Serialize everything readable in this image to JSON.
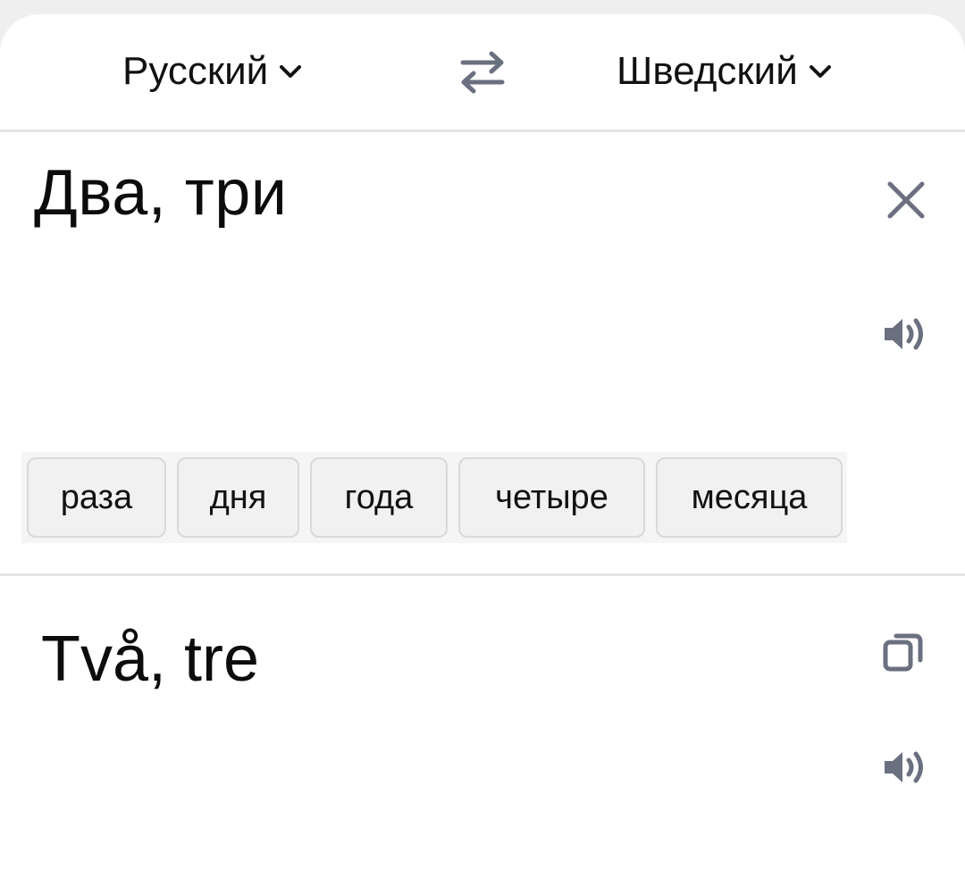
{
  "languages": {
    "source": "Русский",
    "target": "Шведский"
  },
  "icons": {
    "source_chevron": "chevron-down-icon",
    "target_chevron": "chevron-down-icon",
    "swap": "swap-arrows-icon",
    "clear": "close-icon",
    "source_speaker": "speaker-icon",
    "target_speaker": "speaker-icon",
    "copy": "copy-icon"
  },
  "source_text": "Два, три",
  "suggestions": [
    "раза",
    "дня",
    "года",
    "четыре",
    "месяца"
  ],
  "translation_text": "Två, tre",
  "colors": {
    "icon": "#6b7080",
    "divider": "#e3e4e6",
    "chip_bg": "#f1f1f1",
    "chip_border": "#d9d9d9"
  }
}
